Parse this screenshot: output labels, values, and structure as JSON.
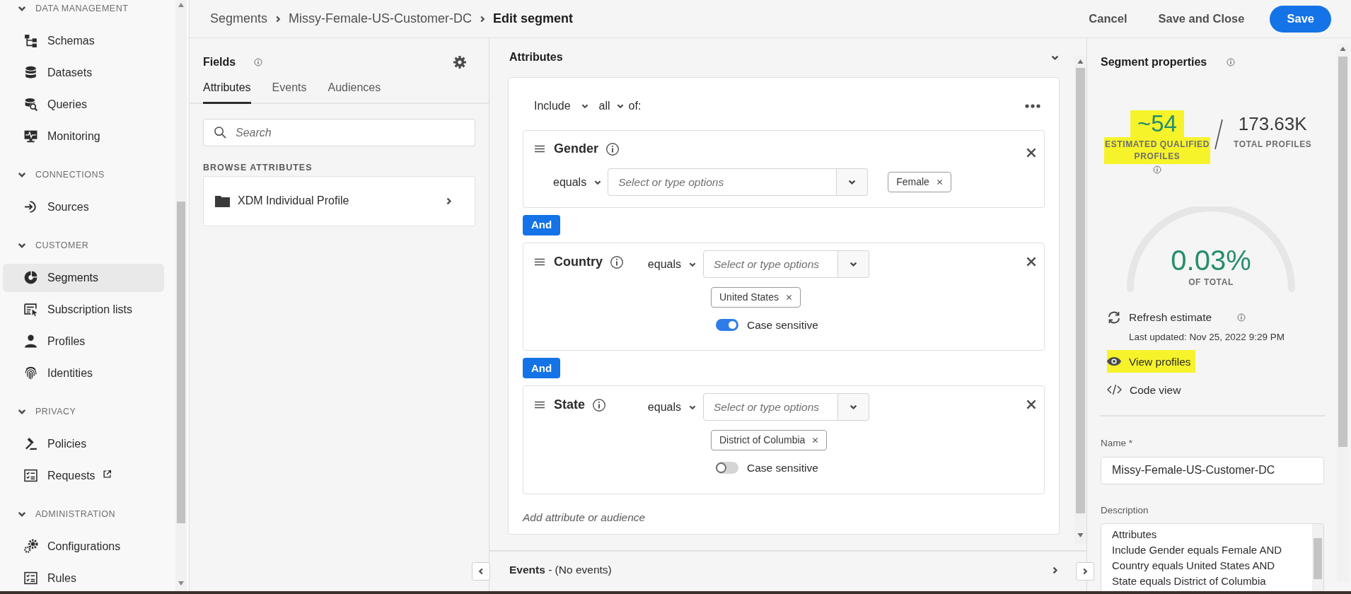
{
  "sidebar": {
    "sections": [
      {
        "title": "DATA MANAGEMENT",
        "expanded": true,
        "items": [
          {
            "label": "Schemas",
            "selected": false
          },
          {
            "label": "Datasets",
            "selected": false
          },
          {
            "label": "Queries",
            "selected": false
          },
          {
            "label": "Monitoring",
            "selected": false
          }
        ]
      },
      {
        "title": "CONNECTIONS",
        "expanded": true,
        "items": [
          {
            "label": "Sources",
            "selected": false
          }
        ]
      },
      {
        "title": "CUSTOMER",
        "expanded": true,
        "items": [
          {
            "label": "Segments",
            "selected": true
          },
          {
            "label": "Subscription lists",
            "selected": false
          },
          {
            "label": "Profiles",
            "selected": false
          },
          {
            "label": "Identities",
            "selected": false
          }
        ]
      },
      {
        "title": "PRIVACY",
        "expanded": true,
        "items": [
          {
            "label": "Policies",
            "selected": false
          },
          {
            "label": "Requests",
            "selected": false,
            "external": true
          }
        ]
      },
      {
        "title": "ADMINISTRATION",
        "expanded": true,
        "items": [
          {
            "label": "Configurations",
            "selected": false
          },
          {
            "label": "Rules",
            "selected": false
          }
        ]
      }
    ]
  },
  "header": {
    "breadcrumb": [
      {
        "label": "Segments",
        "current": false
      },
      {
        "label": "Missy-Female-US-Customer-DC",
        "current": false
      },
      {
        "label": "Edit segment",
        "current": true
      }
    ],
    "actions": [
      "Cancel",
      "Save and Close"
    ],
    "primary": "Save"
  },
  "fields_panel": {
    "title": "Fields",
    "tabs": [
      {
        "label": "Attributes",
        "selected": true
      },
      {
        "label": "Events",
        "selected": false
      },
      {
        "label": "Audiences",
        "selected": false
      }
    ],
    "search": {
      "placeholder": "Search"
    },
    "browse_title": "BROWSE ATTRIBUTES",
    "browse_items": [
      {
        "label": "XDM Individual Profile"
      }
    ]
  },
  "attributes": {
    "title": "Attributes",
    "expanded": true,
    "include": "Include",
    "quantifier": "all",
    "of": "of:",
    "conditions": [
      {
        "kind": "stacked",
        "name": "Gender",
        "operator": "equals",
        "placeholder": "Select or type options",
        "values": [
          "Female"
        ]
      },
      {
        "kind": "inline",
        "connector": "And",
        "name": "Country",
        "operator": "equals",
        "placeholder": "Select or type options",
        "values": [
          "United States"
        ],
        "case_label": "Case sensitive",
        "case_sensitive": true
      },
      {
        "kind": "inline",
        "connector": "And",
        "name": "State",
        "operator": "equals",
        "placeholder": "Select or type options",
        "values": [
          "District of Columbia"
        ],
        "case_label": "Case sensitive",
        "case_sensitive": false
      }
    ],
    "add_hint": "Add attribute or audience"
  },
  "events": {
    "title": "Events",
    "note": "- (No events)"
  },
  "properties": {
    "title": "Segment properties",
    "estimate": {
      "value": "~54",
      "label": "ESTIMATED QUALIFIED PROFILES",
      "highlighted": true
    },
    "total": {
      "value": "173.63K",
      "label": "TOTAL PROFILES"
    },
    "gauge": {
      "percent": "0.03%",
      "label": "OF TOTAL"
    },
    "actions": [
      {
        "kind": "refresh",
        "label": "Refresh estimate",
        "highlighted": false,
        "note": "Last updated: Nov 25, 2022 9:29 PM"
      },
      {
        "kind": "view",
        "label": "View profiles",
        "highlighted": true
      },
      {
        "kind": "code",
        "label": "Code view",
        "highlighted": false
      }
    ],
    "name": {
      "label": "Name *",
      "value": "Missy-Female-US-Customer-DC"
    },
    "description": {
      "label": "Description",
      "lines": [
        "Attributes",
        "Include Gender equals Female AND",
        "Country equals United States AND",
        "State equals District of Columbia"
      ]
    }
  }
}
